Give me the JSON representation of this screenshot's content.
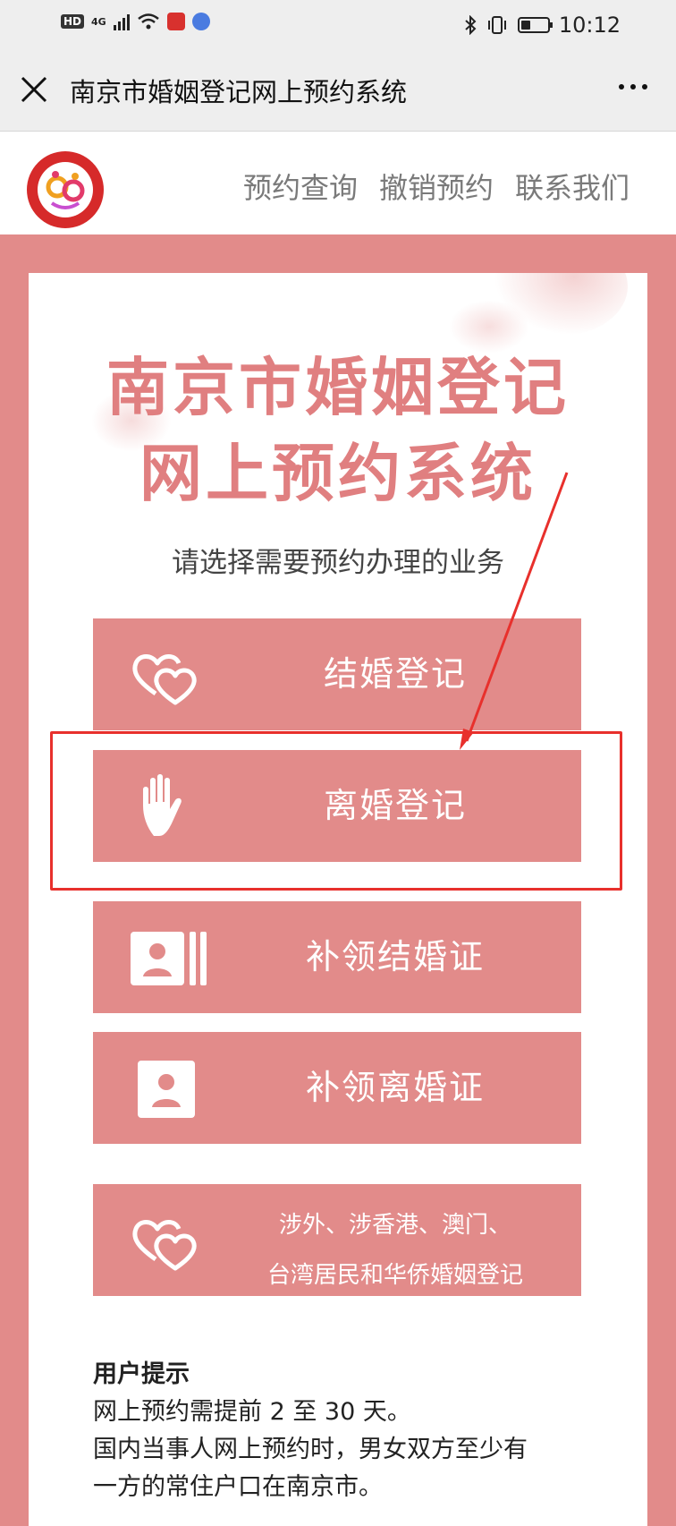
{
  "status_bar": {
    "hd": "HD",
    "network": "4G",
    "time": "10:12"
  },
  "titlebar": {
    "title": "南京市婚姻登记网上预约系统"
  },
  "header": {
    "nav": [
      "预约查询",
      "撤销预约",
      "联系我们"
    ]
  },
  "hero": {
    "line1": "南京市婚姻登记",
    "line2": "网上预约系统",
    "subtitle": "请选择需要预约办理的业务"
  },
  "services": [
    {
      "label": "结婚登记",
      "icon": "hearts-icon"
    },
    {
      "label": "离婚登记",
      "icon": "hand-icon"
    },
    {
      "label": "补领结婚证",
      "icon": "id-card-icon"
    },
    {
      "label": "补领离婚证",
      "icon": "person-card-icon"
    },
    {
      "label_line1": "涉外、涉香港、澳门、",
      "label_line2": "台湾居民和华侨婚姻登记",
      "icon": "hearts-icon"
    }
  ],
  "tips": {
    "title": "用户提示",
    "line1": "网上预约需提前 2 至 30 天。",
    "line2": "国内当事人网上预约时，男女双方至少有",
    "line3": "一方的常住户口在南京市。"
  },
  "colors": {
    "brand_pink": "#e28b8a",
    "annotation_red": "#e8302c"
  }
}
